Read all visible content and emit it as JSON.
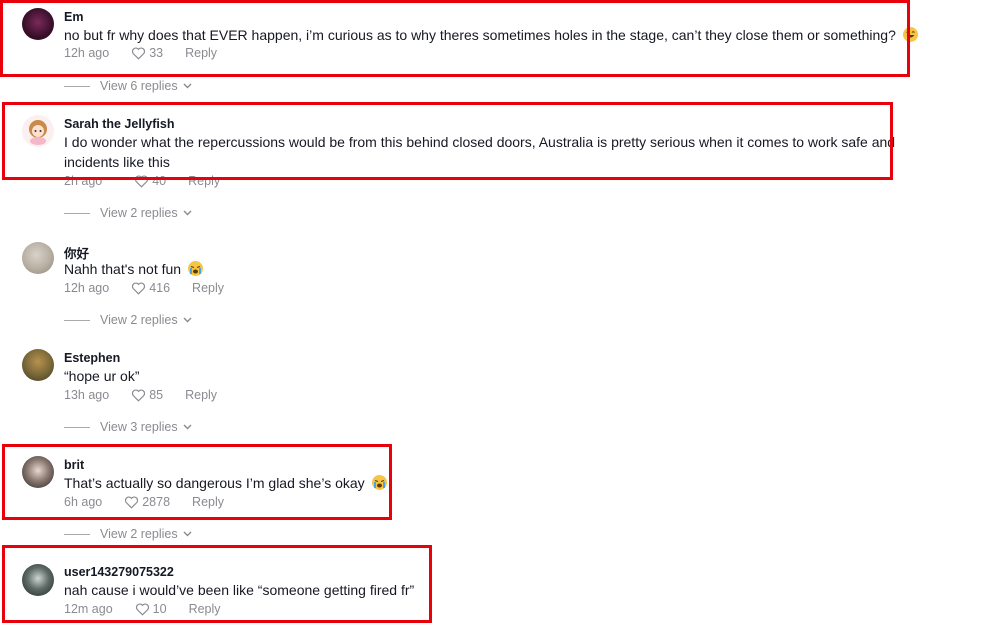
{
  "comments": [
    {
      "username": "Em",
      "text": "no but fr why does that EVER happen, i’m curious as to why theres sometimes holes in the stage, can’t they close them or something?",
      "time": "12h ago",
      "likes": "33",
      "reply": "Reply",
      "view_replies": "View 6 replies"
    },
    {
      "username": "Sarah the Jellyfish",
      "text_line1": "I do wonder what the repercussions would be from this behind closed doors, Australia is pretty serious when it comes to work safe and",
      "text_line2": "incidents like this",
      "time": "2h ago",
      "likes": "40",
      "reply": "Reply",
      "view_replies": "View 2 replies"
    },
    {
      "username": "你好",
      "text": "Nahh that's not fun",
      "time": "12h ago",
      "likes": "416",
      "reply": "Reply",
      "view_replies": "View 2 replies"
    },
    {
      "username": "Estephen",
      "text": "“hope ur ok”",
      "time": "13h ago",
      "likes": "85",
      "reply": "Reply",
      "view_replies": "View 3 replies"
    },
    {
      "username": "brit",
      "text": "That’s actually so dangerous I’m glad she’s okay",
      "time": "6h ago",
      "likes": "2878",
      "reply": "Reply",
      "view_replies": "View 2 replies"
    },
    {
      "username": "user143279075322",
      "text": "nah cause i would’ve been like “someone getting fired fr”",
      "time": "12m ago",
      "likes": "10",
      "reply": "Reply"
    }
  ],
  "icons": {
    "like": "heart-outline-icon",
    "chevron": "chevron-down-icon"
  },
  "colors": {
    "highlight": "#e8000b",
    "meta": "#8a8b91",
    "text": "#161823"
  }
}
